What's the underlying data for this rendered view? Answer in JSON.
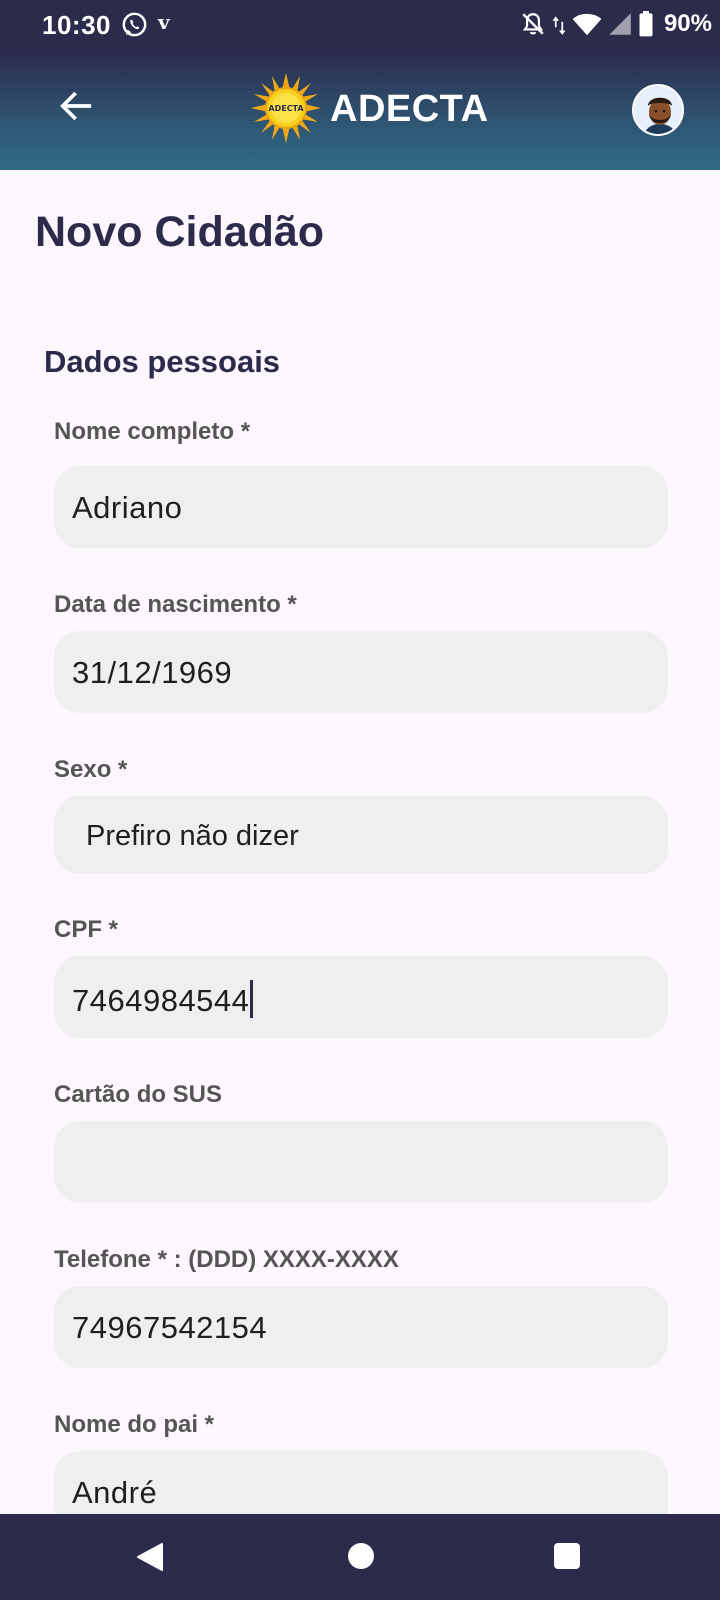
{
  "status_bar": {
    "time": "10:30",
    "vpn_glyph": "v",
    "battery_percent": "90%",
    "icons": [
      "whatsapp-icon",
      "vpn-icon",
      "mute-bell-icon",
      "data-arrows-icon",
      "wifi-icon",
      "cellular-signal-icon",
      "battery-icon"
    ]
  },
  "app_bar": {
    "back_icon": "arrow-left-icon",
    "logo_text": "ADECTA",
    "brand": "ADECTA",
    "avatar_icon": "user-avatar"
  },
  "page": {
    "title": "Novo Cidadão",
    "section_title": "Dados pessoais"
  },
  "form": {
    "nome_completo": {
      "label": "Nome completo *",
      "value": "Adriano"
    },
    "data_nascimento": {
      "label": "Data de nascimento *",
      "value": "31/12/1969"
    },
    "sexo": {
      "label": "Sexo *",
      "value": "Prefiro não dizer"
    },
    "cpf": {
      "label": "CPF *",
      "value": "7464984544"
    },
    "cartao_sus": {
      "label": "Cartão do SUS",
      "value": ""
    },
    "telefone": {
      "label": "Telefone * : (DDD) XXXX-XXXX",
      "value": "74967542154"
    },
    "nome_pai": {
      "label": "Nome do pai *",
      "value": "André"
    }
  },
  "nav_bar": {
    "icons": [
      "nav-back-icon",
      "nav-home-icon",
      "nav-recents-icon"
    ]
  },
  "colors": {
    "primary_dark": "#2c2b4c",
    "app_bar_gradient_end": "#2f6b84",
    "background": "#fcf6fd",
    "field_background": "#efefef",
    "label_text": "#555555",
    "sun_logo": "#f5c518"
  }
}
